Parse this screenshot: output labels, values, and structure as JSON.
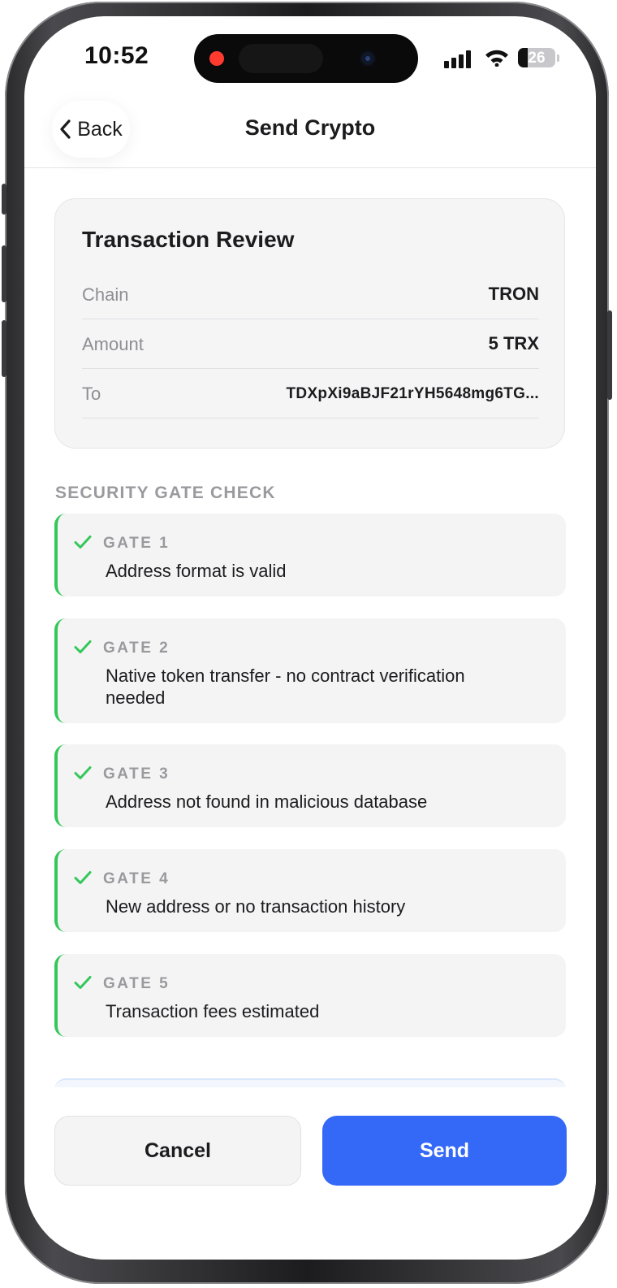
{
  "status_bar": {
    "time": "10:52",
    "battery_level": "26",
    "battery_fraction": 0.26,
    "icons": [
      "cellular-signal-icon",
      "wifi-icon",
      "battery-icon"
    ]
  },
  "header": {
    "back_label": "Back",
    "title": "Send Crypto"
  },
  "review": {
    "title": "Transaction Review",
    "rows": [
      {
        "label": "Chain",
        "value": "TRON"
      },
      {
        "label": "Amount",
        "value": "5 TRX"
      },
      {
        "label": "To",
        "value": "TDXpXi9aBJF21rYH5648mg6TG..."
      }
    ]
  },
  "security": {
    "heading": "SECURITY GATE CHECK",
    "gates": [
      {
        "label": "GATE 1",
        "status": "passed",
        "text": "Address format is valid"
      },
      {
        "label": "GATE 2",
        "status": "passed",
        "text": "Native token transfer - no contract verification needed"
      },
      {
        "label": "GATE 3",
        "status": "passed",
        "text": "Address not found in malicious database"
      },
      {
        "label": "GATE 4",
        "status": "passed",
        "text": "New address or no transaction history"
      },
      {
        "label": "GATE 5",
        "status": "passed",
        "text": "Transaction fees estimated"
      }
    ]
  },
  "actions": {
    "cancel_label": "Cancel",
    "send_label": "Send"
  },
  "colors": {
    "accent": "#3468f7",
    "success": "#34c759",
    "recording": "#ff3b30"
  }
}
